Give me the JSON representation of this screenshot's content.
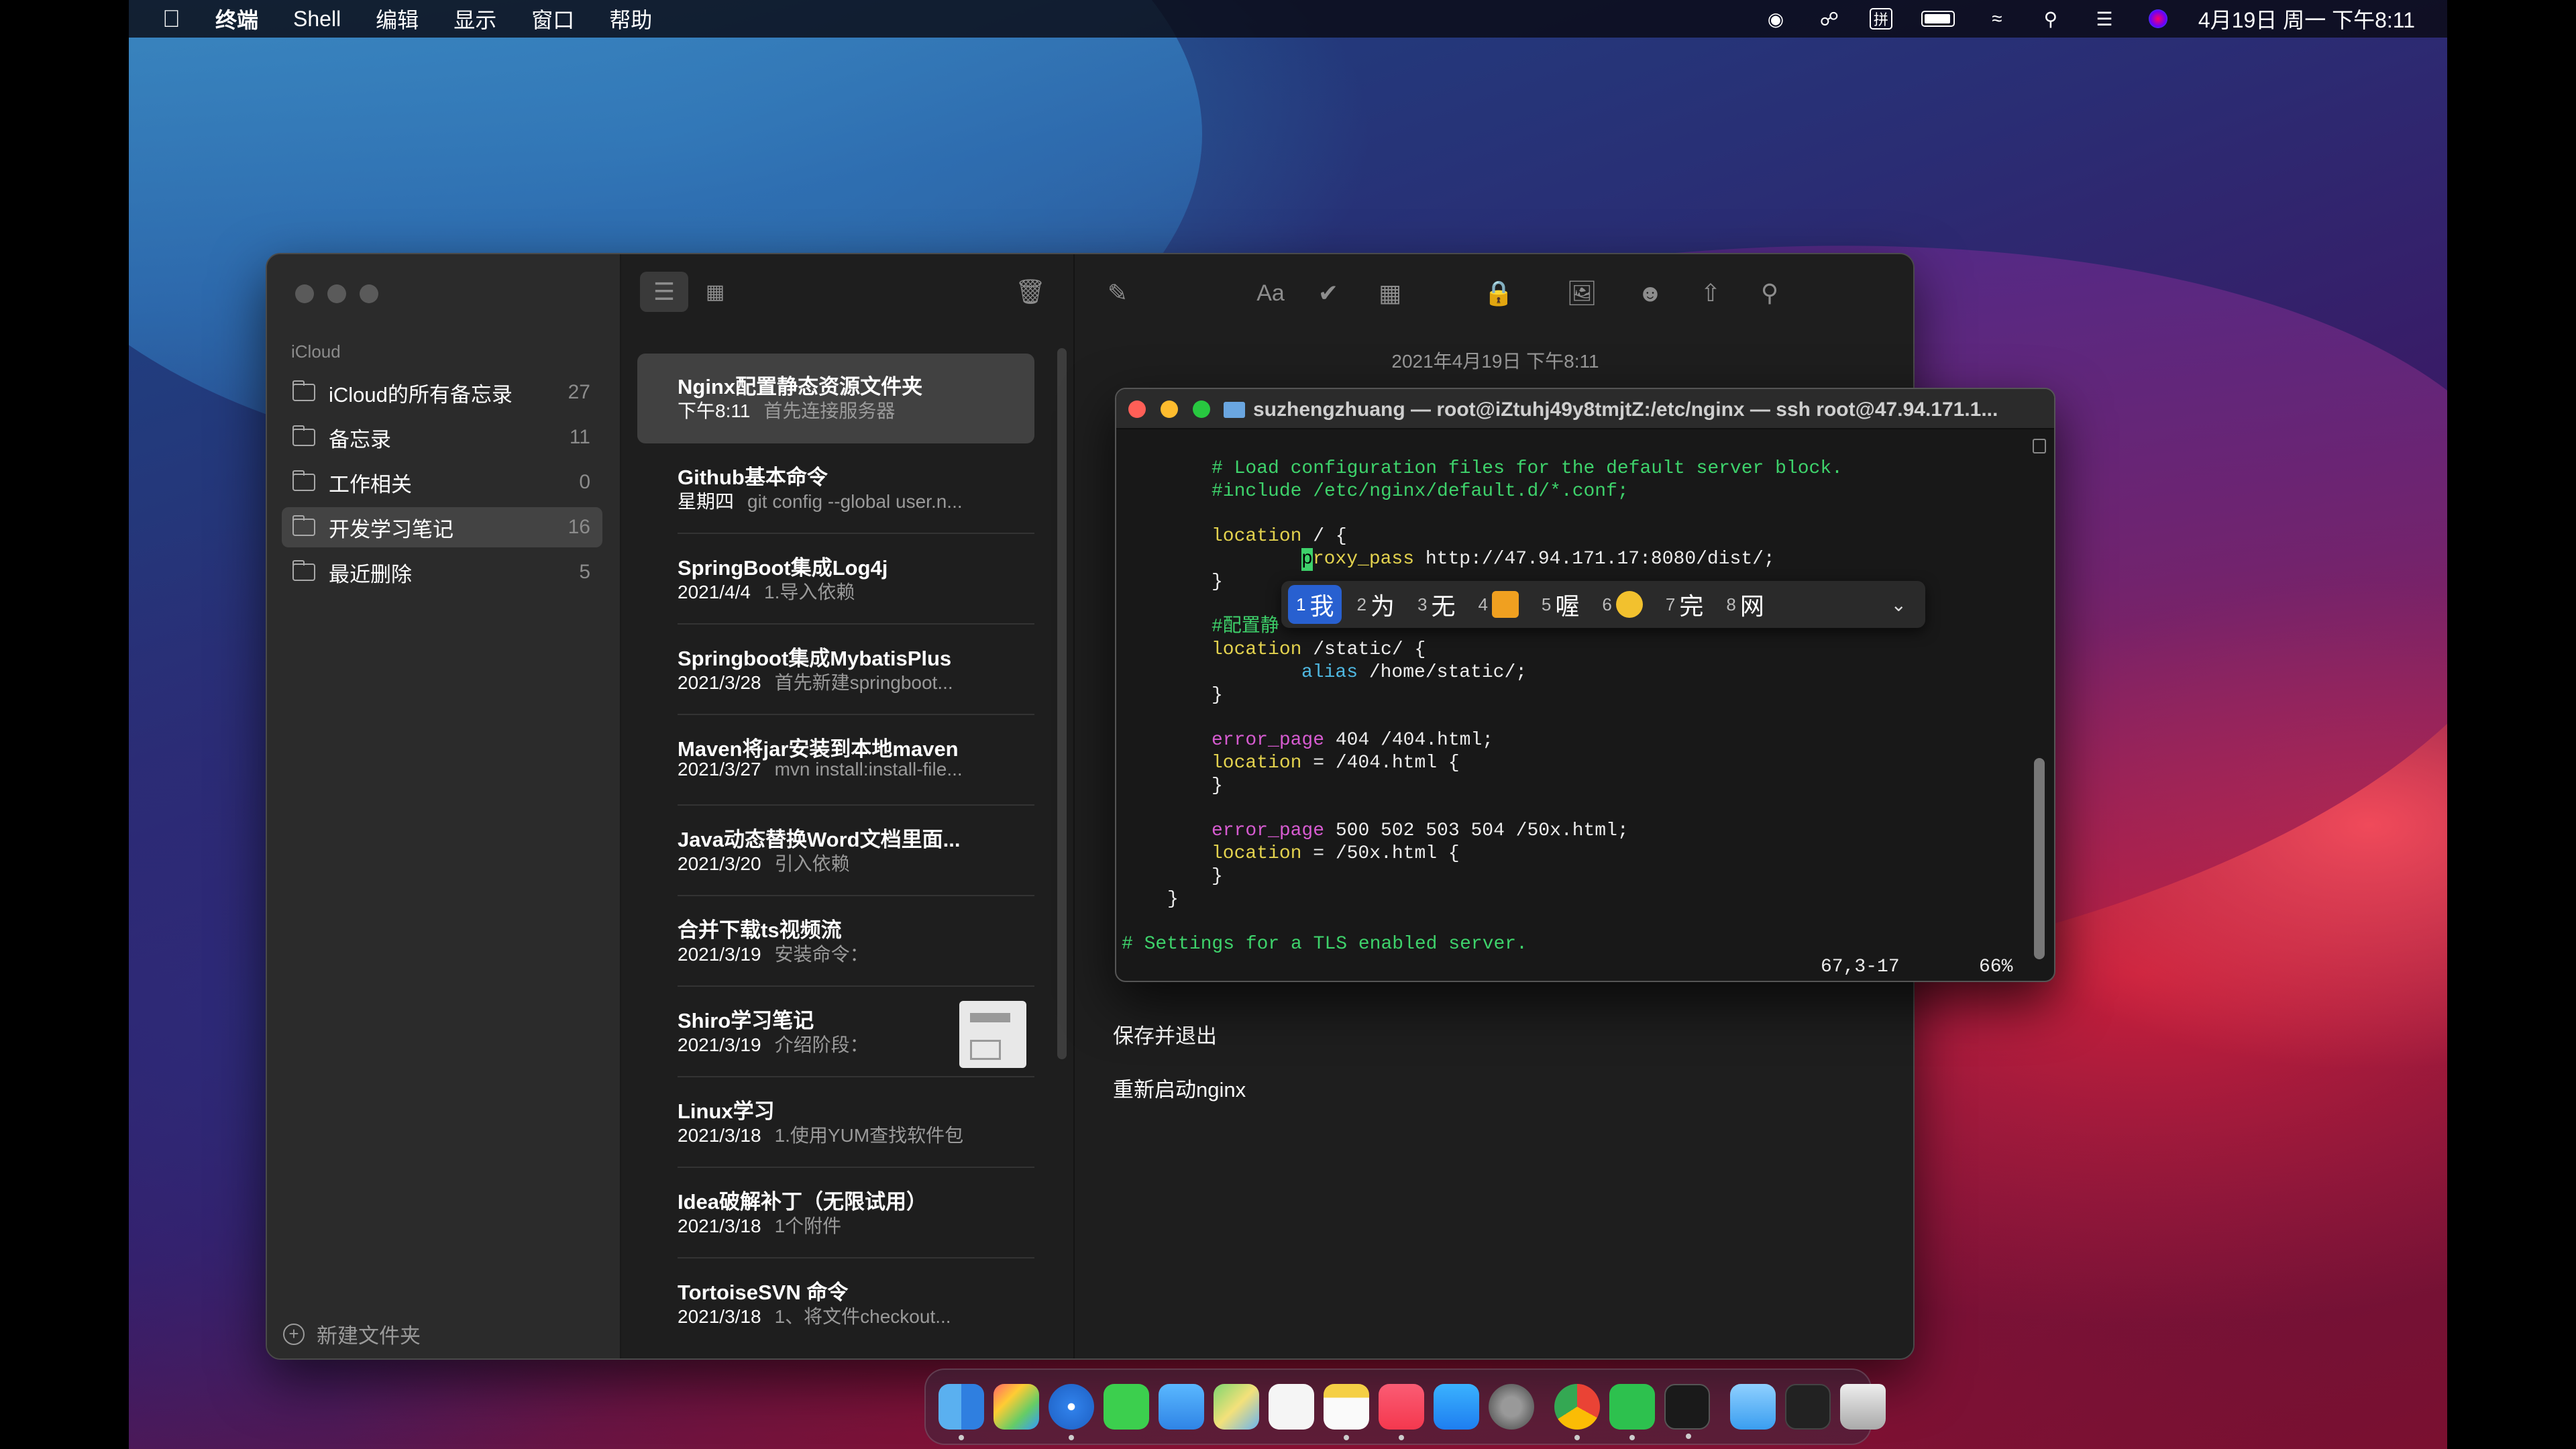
{
  "menubar": {
    "app": "终端",
    "items": [
      "Shell",
      "编辑",
      "显示",
      "窗口",
      "帮助"
    ],
    "datetime": "4月19日 周一 下午8:11",
    "icons": [
      "screen-record-icon",
      "wechat-icon",
      "input-method-icon",
      "battery-icon",
      "wifi-icon",
      "spotlight-icon",
      "control-center-icon",
      "siri-icon"
    ]
  },
  "notes": {
    "sidebar": {
      "section": "iCloud",
      "folders": [
        {
          "label": "iCloud的所有备忘录",
          "count": "27"
        },
        {
          "label": "备忘录",
          "count": "11"
        },
        {
          "label": "工作相关",
          "count": "0"
        },
        {
          "label": "开发学习笔记",
          "count": "16"
        },
        {
          "label": "最近删除",
          "count": "5"
        }
      ],
      "new_folder": "新建文件夹"
    },
    "list": [
      {
        "title": "Nginx配置静态资源文件夹",
        "date": "下午8:11",
        "preview": "首先连接服务器"
      },
      {
        "title": "Github基本命令",
        "date": "星期四",
        "preview": "git config --global user.n..."
      },
      {
        "title": "SpringBoot集成Log4j",
        "date": "2021/4/4",
        "preview": "1.导入依赖"
      },
      {
        "title": "Springboot集成MybatisPlus",
        "date": "2021/3/28",
        "preview": "首先新建springboot..."
      },
      {
        "title": "Maven将jar安装到本地maven",
        "date": "2021/3/27",
        "preview": "mvn install:install-file..."
      },
      {
        "title": "Java动态替换Word文档里面...",
        "date": "2021/3/20",
        "preview": "引入依赖"
      },
      {
        "title": "合并下载ts视频流",
        "date": "2021/3/19",
        "preview": "安装命令："
      },
      {
        "title": "Shiro学习笔记",
        "date": "2021/3/19",
        "preview": "介绍阶段："
      },
      {
        "title": "Linux学习",
        "date": "2021/3/18",
        "preview": "1.使用YUM查找软件包"
      },
      {
        "title": "Idea破解补丁（无限试用）",
        "date": "2021/3/18",
        "preview": "1个附件"
      },
      {
        "title": "TortoiseSVN 命令",
        "date": "2021/3/18",
        "preview": "1、将文件checkout..."
      }
    ],
    "editor": {
      "date": "2021年4月19日 下午8:11",
      "line1": "保存并退出",
      "line2": "重新启动nginx"
    }
  },
  "terminal": {
    "title": "suzhengzhuang — root@iZtuhj49y8tmjtZ:/etc/nginx — ssh root@47.94.171.1...",
    "lines": {
      "l1": "# Load configuration files for the default server block.",
      "l2": "#include /etc/nginx/default.d/*.conf;",
      "l4a": "location",
      "l4b": " / {",
      "l5cursor": "p",
      "l5a": "roxy_pass",
      "l5b": " http://47.94.171.17:8080/dist/;",
      "l6": "}",
      "l8": "#配置静",
      "l9a": "location",
      "l9b": " /static/ {",
      "l10a": "alias",
      "l10b": " /home/static/;",
      "l11": "}",
      "l13a": "error_page",
      "l13b": " 404 /404.html;",
      "l14a": "location",
      "l14b": " = /404.html {",
      "l15": "}",
      "l17a": "error_page",
      "l17b": " 500 502 503 504 /50x.html;",
      "l18a": "location",
      "l18b": " = /50x.html {",
      "l19": "}",
      "l20": "}",
      "l22": "# Settings for a TLS enabled server."
    },
    "status_pos": "67,3-17",
    "status_pct": "66%"
  },
  "ime": {
    "candidates": [
      {
        "n": "1",
        "c": "我"
      },
      {
        "n": "2",
        "c": "为"
      },
      {
        "n": "3",
        "c": "无"
      },
      {
        "n": "4",
        "c": ""
      },
      {
        "n": "5",
        "c": "喔"
      },
      {
        "n": "6",
        "c": ""
      },
      {
        "n": "7",
        "c": "完"
      },
      {
        "n": "8",
        "c": "网"
      }
    ]
  },
  "dock": {
    "apps": [
      "Finder",
      "Launchpad",
      "Safari",
      "Messages",
      "Mail",
      "Maps",
      "Reminders",
      "Notes",
      "Music",
      "App Store",
      "System Preferences",
      "Chrome",
      "WeChat",
      "Terminal",
      "Downloads",
      "Activity",
      "Trash"
    ],
    "colors": {
      "finder": "#3a8ee6",
      "safari": "#2f7fe8",
      "messages": "#3ccf4e",
      "mail": "#2f84e6",
      "notes": "#f5cf45",
      "music": "#f4384e",
      "appstore": "#1e7ef0",
      "wechat": "#2dc14e",
      "terminal": "#1a1a1a"
    }
  },
  "colors": {
    "ime_selected": "#2860d0",
    "comment": "#3ed26b",
    "keyword": "#e3d24e",
    "directive": "#d65bd0",
    "alias": "#4fb7e0"
  }
}
